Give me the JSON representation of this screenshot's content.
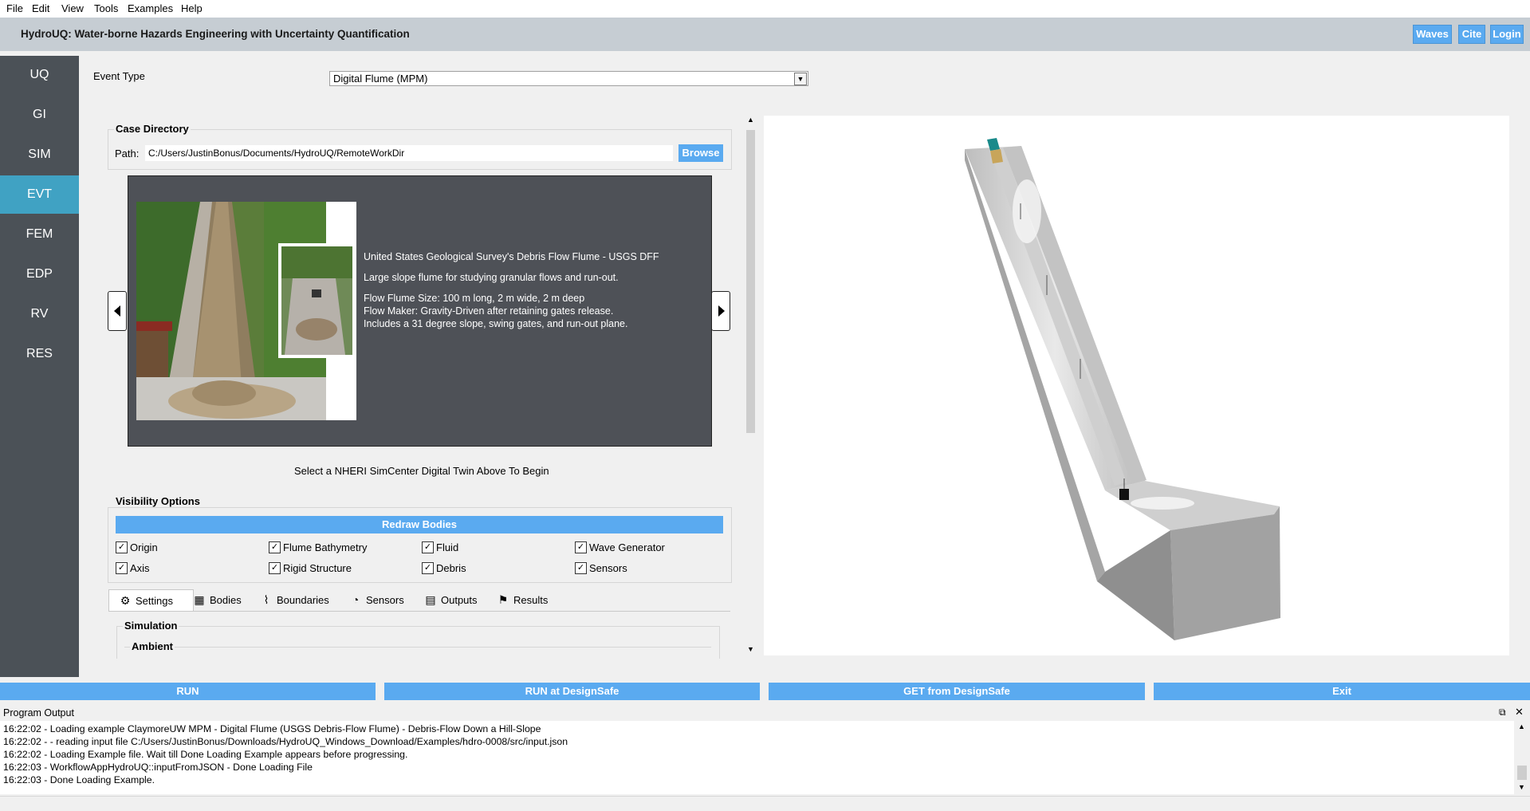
{
  "menu": [
    "File",
    "Edit",
    "View",
    "Tools",
    "Examples",
    "Help"
  ],
  "app_title": "HydroUQ: Water-borne Hazards Engineering with Uncertainty Quantification",
  "header_buttons": [
    "Waves",
    "Cite",
    "Login"
  ],
  "sidebar": {
    "items": [
      "UQ",
      "GI",
      "SIM",
      "EVT",
      "FEM",
      "EDP",
      "RV",
      "RES"
    ],
    "active": "EVT"
  },
  "event": {
    "label": "Event Type",
    "selected": "Digital Flume (MPM)"
  },
  "case_directory": {
    "title": "Case Directory",
    "path_label": "Path:",
    "path_value": "C:/Users/JustinBonus/Documents/HydroUQ/RemoteWorkDir",
    "browse_label": "Browse"
  },
  "carousel": {
    "title_line": "United States Geological Survey's Debris Flow Flume - USGS DFF",
    "description": "Large slope flume for studying granular flows and run-out.",
    "size_line": "Flow Flume Size: 100 m long, 2 m wide, 2 m deep",
    "maker_line": "Flow Maker: Gravity-Driven after retaining gates release.",
    "includes_line": "Includes a 31 degree slope, swing gates, and run-out plane.",
    "prompt": "Select a NHERI SimCenter Digital Twin Above To Begin"
  },
  "visibility": {
    "title": "Visibility Options",
    "redraw_label": "Redraw Bodies",
    "checkboxes": [
      {
        "label": "Origin",
        "checked": true
      },
      {
        "label": "Flume Bathymetry",
        "checked": true
      },
      {
        "label": "Fluid",
        "checked": true
      },
      {
        "label": "Wave Generator",
        "checked": true
      },
      {
        "label": "Axis",
        "checked": true
      },
      {
        "label": "Rigid Structure",
        "checked": true
      },
      {
        "label": "Debris",
        "checked": true
      },
      {
        "label": "Sensors",
        "checked": true
      }
    ]
  },
  "tabs": [
    "Settings",
    "Bodies",
    "Boundaries",
    "Sensors",
    "Outputs",
    "Results"
  ],
  "active_tab": "Settings",
  "settings": {
    "simulation_title": "Simulation",
    "ambient_title": "Ambient"
  },
  "run_buttons": [
    "RUN",
    "RUN at DesignSafe",
    "GET from DesignSafe",
    "Exit"
  ],
  "output": {
    "title": "Program Output",
    "lines": [
      "16:22:02 - Loading example ClaymoreUW MPM - Digital Flume (USGS Debris-Flow Flume) - Debris-Flow Down a Hill-Slope",
      "16:22:02 -  - reading input file C:/Users/JustinBonus/Downloads/HydroUQ_Windows_Download/Examples/hdro-0008/src/input.json",
      "16:22:02 - Loading Example file. Wait till Done Loading Example appears before progressing.",
      "16:22:03 - WorkflowAppHydroUQ::inputFromJSON - Done Loading File",
      "16:22:03 - Done Loading Example."
    ]
  },
  "colors": {
    "accent": "#5aaaf0",
    "sidebar_bg": "#4b5157",
    "sidebar_active": "#40a2c3",
    "title_bar": "#c6cdd3"
  }
}
